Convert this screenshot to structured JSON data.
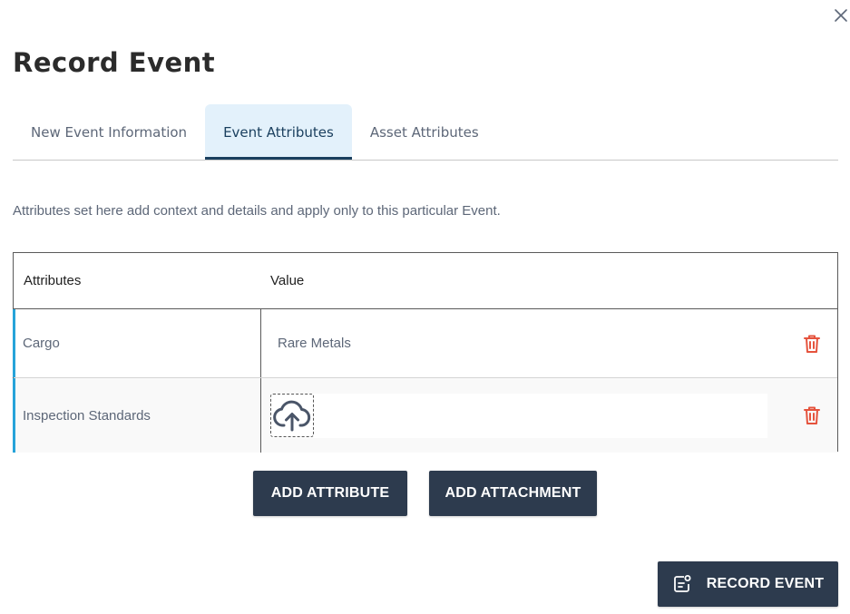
{
  "dialog": {
    "title": "Record Event"
  },
  "tabs": [
    {
      "label": "New Event Information",
      "active": false
    },
    {
      "label": "Event Attributes",
      "active": true
    },
    {
      "label": "Asset Attributes",
      "active": false
    }
  ],
  "description": "Attributes set here add context and details and apply only to this particular Event.",
  "table": {
    "headers": {
      "attribute": "Attributes",
      "value": "Value"
    },
    "rows": [
      {
        "attribute": "Cargo",
        "value": "Rare Metals"
      },
      {
        "attribute": "Inspection Standards",
        "value": ""
      }
    ]
  },
  "buttons": {
    "add_attribute": "ADD ATTRIBUTE",
    "add_attachment": "ADD ATTACHMENT",
    "record_event": "RECORD EVENT"
  },
  "icons": {
    "close": "close-icon",
    "delete": "trash-icon",
    "upload": "cloud-upload-icon",
    "record": "record-event-icon"
  },
  "colors": {
    "primary_button": "#2d3b4e",
    "active_tab_bg": "#e3f1fb",
    "active_tab_border": "#1a3f5e",
    "row_accent": "#26a3d9",
    "delete": "#e5533d"
  }
}
